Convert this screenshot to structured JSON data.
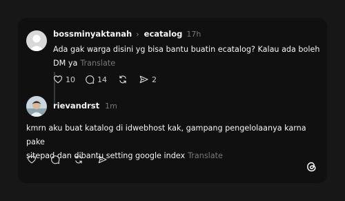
{
  "post": {
    "username": "bossminyaktanah",
    "reply_to": "ecatalog",
    "time": "17h",
    "text_line1": "Ada gak warga disini yg bisa bantu buatin ecatalog? Kalau ada boleh",
    "text_line2": "DM ya",
    "translate": "Translate",
    "likes": "10",
    "comments": "14",
    "shares": "2"
  },
  "reply": {
    "username": "rievandrst",
    "time": "1m",
    "text_line1": "kmrn aku buat katalog di idwebhost kak, gampang pengelolaanya karna pake",
    "text_line2": "sitepad dan dibantu setting google index",
    "translate": "Translate"
  },
  "icons": {
    "like": "heart-icon",
    "comment": "speech-bubble-icon",
    "repost": "repost-arrows-icon",
    "share": "paper-plane-icon",
    "brand": "threads-logo-icon"
  },
  "colors": {
    "background": "#171717",
    "card": "#101010",
    "text": "#f3f5f7",
    "muted": "#777777"
  }
}
